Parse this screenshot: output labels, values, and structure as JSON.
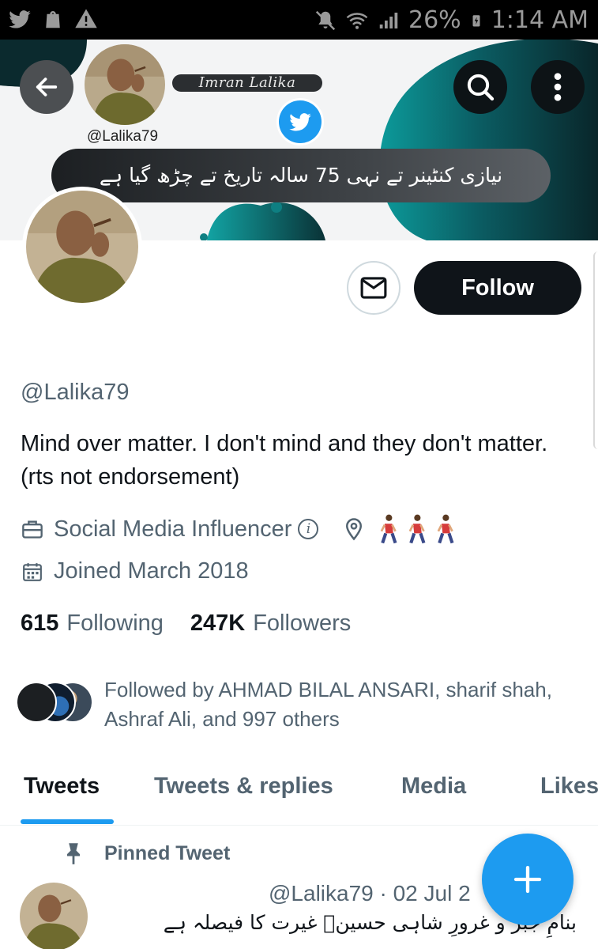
{
  "status_bar": {
    "battery": "26%",
    "time": "1:14 AM",
    "left_icons": [
      "twitter-icon",
      "shopping-bag-icon",
      "warning-icon"
    ],
    "right_icons": [
      "mute-icon",
      "wifi-icon",
      "signal-icon",
      "battery-charging-icon"
    ]
  },
  "banner": {
    "name_text": "Imran Lalika",
    "handle_text": "@Lalika79",
    "urdu_text": "نیازی کنٹینر تے نہی 75 سالہ تاریخ تے چڑھ گیا ہے",
    "colors": {
      "teal": "#0f8f8f",
      "dark": "#0a2e33",
      "pill": "#2b2e31"
    }
  },
  "actions": {
    "follow_label": "Follow",
    "icons": [
      "back-arrow-icon",
      "search-icon",
      "more-vertical-icon",
      "message-icon"
    ]
  },
  "profile": {
    "handle": "@Lalika79",
    "bio": "Mind over matter. I don't mind and they don't matter.  (rts not endorsement)",
    "category": "Social Media Influencer",
    "location_emoji": "🚶🚶🚶",
    "joined": "Joined March 2018",
    "following_count": "615",
    "following_label": "Following",
    "followers_count": "247K",
    "followers_label": "Followers",
    "followed_by": "Followed by AHMAD BILAL ANSARI, sharif shah, Ashraf Ali, and 997 others"
  },
  "tabs": [
    {
      "label": "Tweets",
      "active": true
    },
    {
      "label": "Tweets & replies",
      "active": false
    },
    {
      "label": "Media",
      "active": false
    },
    {
      "label": "Likes",
      "active": false
    }
  ],
  "pinned": {
    "label": "Pinned Tweet",
    "meta": "@Lalika79 · 02 Jul 2",
    "text": "بنامِ جبر و غرورِ شاہی حسینؑ غیرت کا فیصلہ ہے"
  },
  "accent_color": "#1d9bf0"
}
